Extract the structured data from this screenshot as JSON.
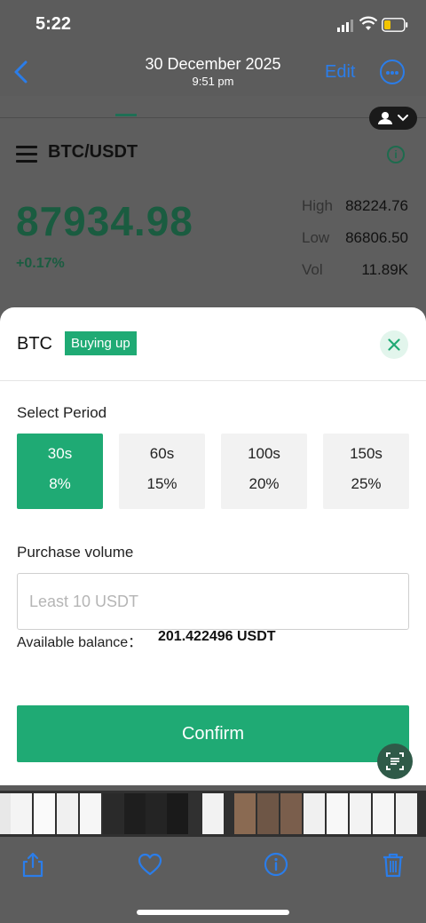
{
  "status_bar": {
    "time": "5:22"
  },
  "nav": {
    "date": "30 December 2025",
    "time": "9:51 pm",
    "edit_label": "Edit"
  },
  "app": {
    "pair": "BTC/USDT",
    "price": "87934.98",
    "change": "+0.17%",
    "stats": [
      {
        "label": "High",
        "value": "88224.76"
      },
      {
        "label": "Low",
        "value": "86806.50"
      },
      {
        "label": "Vol",
        "value": "11.89K"
      }
    ]
  },
  "modal": {
    "coin": "BTC",
    "badge": "Buying up",
    "select_period_label": "Select Period",
    "periods": [
      {
        "time": "30s",
        "rate": "8%",
        "selected": true
      },
      {
        "time": "60s",
        "rate": "15%",
        "selected": false
      },
      {
        "time": "100s",
        "rate": "20%",
        "selected": false
      },
      {
        "time": "150s",
        "rate": "25%",
        "selected": false
      }
    ],
    "purchase_volume_label": "Purchase volume",
    "volume_placeholder": "Least 10 USDT",
    "available_balance_label": "Available balance：",
    "available_balance_value": "201.422496 USDT",
    "confirm_label": "Confirm"
  },
  "colors": {
    "accent_green": "#1faa74",
    "ios_blue": "#2b7de9",
    "price_green": "#1a5c40"
  },
  "icons": {
    "back": "chevron-left-icon",
    "more": "ellipsis-circle-icon",
    "close": "close-icon",
    "share": "share-icon",
    "favorite": "heart-icon",
    "info": "info-icon",
    "delete": "trash-icon"
  }
}
